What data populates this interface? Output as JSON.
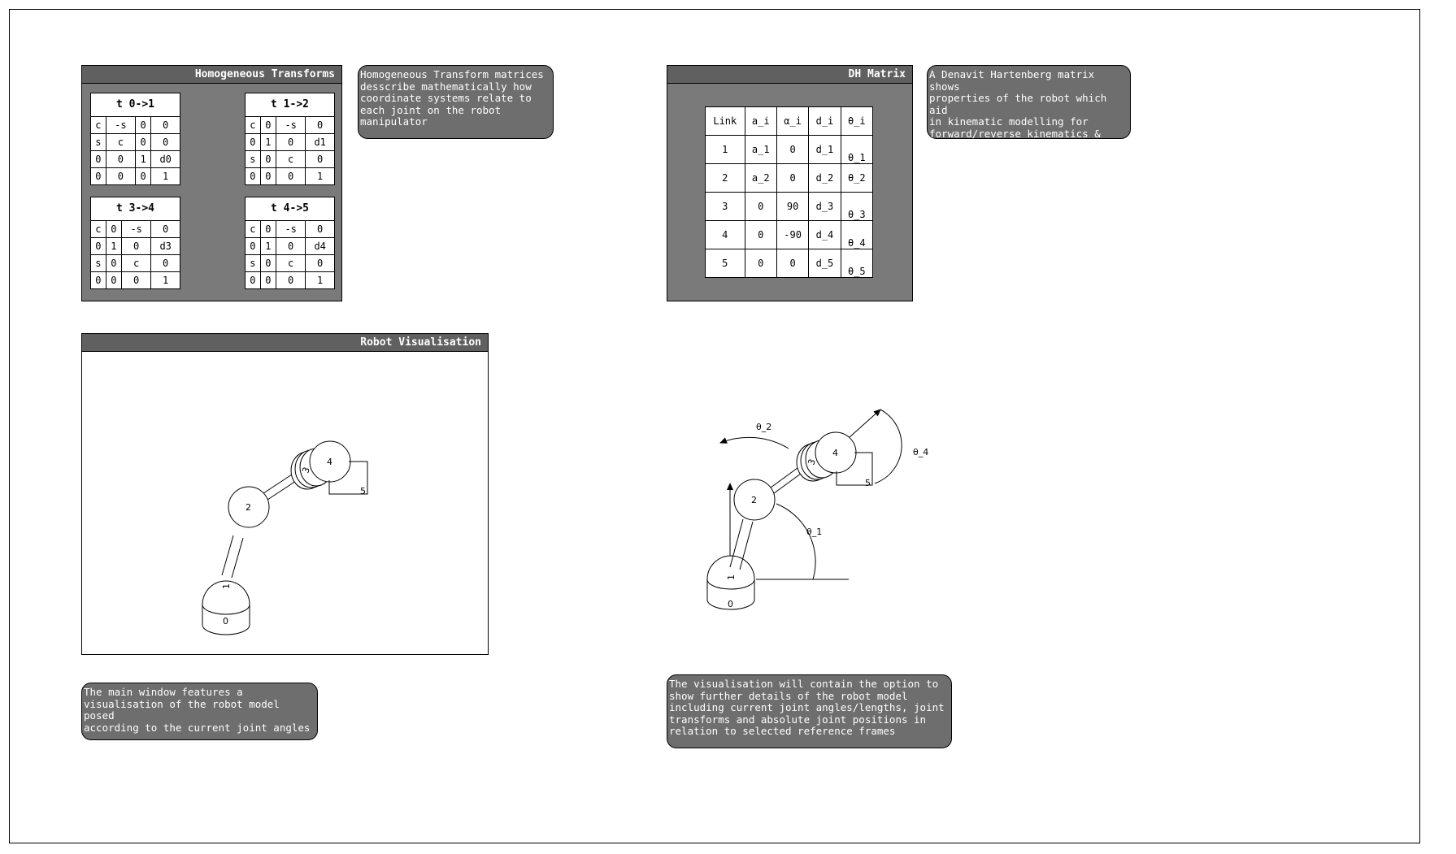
{
  "homogeneous": {
    "title": "Homogeneous Transforms",
    "matrices": [
      {
        "title": "t 0->1",
        "rows": [
          [
            "c",
            "-s",
            "0",
            "0"
          ],
          [
            "s",
            "c",
            "0",
            "0"
          ],
          [
            "0",
            "0",
            "1",
            "d0"
          ],
          [
            "0",
            "0",
            "0",
            "1"
          ]
        ]
      },
      {
        "title": "t 1->2",
        "rows": [
          [
            "c",
            "0",
            "-s",
            "0"
          ],
          [
            "0",
            "1",
            "0",
            "d1"
          ],
          [
            "s",
            "0",
            "c",
            "0"
          ],
          [
            "0",
            "0",
            "0",
            "1"
          ]
        ]
      },
      {
        "title": "t 3->4",
        "rows": [
          [
            "c",
            "0",
            "-s",
            "0"
          ],
          [
            "0",
            "1",
            "0",
            "d3"
          ],
          [
            "s",
            "0",
            "c",
            "0"
          ],
          [
            "0",
            "0",
            "0",
            "1"
          ]
        ]
      },
      {
        "title": "t 4->5",
        "rows": [
          [
            "c",
            "0",
            "-s",
            "0"
          ],
          [
            "0",
            "1",
            "0",
            "d4"
          ],
          [
            "s",
            "0",
            "c",
            "0"
          ],
          [
            "0",
            "0",
            "0",
            "1"
          ]
        ]
      }
    ],
    "note": "Homogeneous Transform matrices\ndesscribe mathematically how\ncoordinate systems relate to\neach joint on the robot\nmanipulator"
  },
  "dh": {
    "title": "DH Matrix",
    "headers": [
      "Link",
      "a_i",
      "α_i",
      "d_i",
      "θ_i"
    ],
    "rows": [
      [
        "1",
        "a_1",
        "0",
        "d_1",
        "θ_1"
      ],
      [
        "2",
        "a_2",
        "0",
        "d_2",
        "θ_2"
      ],
      [
        "3",
        "0",
        "90",
        "d_3",
        "θ_3"
      ],
      [
        "4",
        "0",
        "-90",
        "d_4",
        "θ_4"
      ],
      [
        "5",
        "0",
        "0",
        "d_5",
        "θ_5"
      ]
    ],
    "note": "A Denavit Hartenberg matrix shows\nproperties of the robot which aid\nin kinematic modelling for\nforward/reverse kinematics &\nmotion planning"
  },
  "visualisation": {
    "title": "Robot Visualisation",
    "note": "The main window features a\nvisualisation of the robot model posed\naccording to the current joint angles",
    "joint_labels": [
      "0",
      "1",
      "2",
      "3",
      "4",
      "5"
    ]
  },
  "detail": {
    "angle_labels": [
      "θ_1",
      "θ_2",
      "θ_4"
    ],
    "joint_labels": [
      "0",
      "1",
      "2",
      "3",
      "4",
      "5"
    ],
    "note": "The visualisation will contain the option to\nshow further details of the robot model\nincluding current joint angles/lengths, joint\ntransforms and absolute joint positions in\nrelation to selected reference frames"
  }
}
